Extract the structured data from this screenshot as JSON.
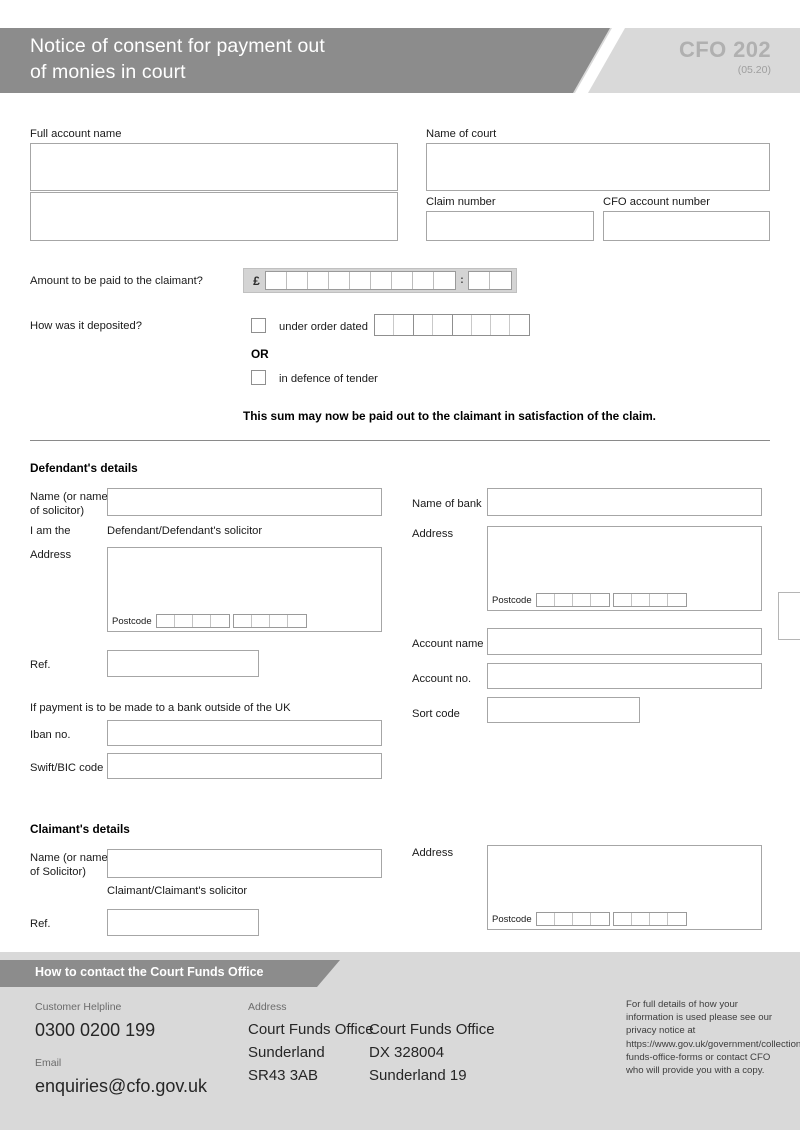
{
  "header": {
    "title_line1": "Notice of consent for payment out",
    "title_line2": "of monies in court",
    "form_code": "CFO 202",
    "form_version": "(05.20)"
  },
  "account": {
    "full_account_name_label": "Full account name",
    "full_account_name_value": "",
    "full_account_name_value2": ""
  },
  "court": {
    "name_of_court_label": "Name of court",
    "name_of_court_value": "",
    "claim_number_label": "Claim number",
    "claim_number_value": "",
    "cfo_account_number_label": "CFO account number",
    "cfo_account_number_value": ""
  },
  "amount": {
    "label": "Amount to be paid to the claimant?",
    "currency_symbol": "£",
    "decimal_separator": ":",
    "pounds_cells": 9,
    "pence_cells": 2,
    "value": ""
  },
  "deposit": {
    "label": "How was it deposited?",
    "option_order_label": "under order dated",
    "option_order_checked": false,
    "or_label": "OR",
    "option_tender_label": "in defence of tender",
    "option_tender_checked": false,
    "date_value": ""
  },
  "statement": "This sum may now be paid out to the claimant in satisfaction of the claim.",
  "defendant": {
    "section_title": "Defendant's details",
    "name_label_line1": "Name (or name",
    "name_label_line2": "of solicitor)",
    "name_value": "",
    "i_am_the_label": "I am the",
    "i_am_the_value": "Defendant/Defendant's solicitor",
    "address_label": "Address",
    "address_value": "",
    "postcode_label": "Postcode",
    "postcode_value": "",
    "ref_label": "Ref.",
    "ref_value": "",
    "overseas_note": "If payment is to be made to a bank outside of the UK",
    "iban_label": "Iban no.",
    "iban_value": "",
    "swift_label": "Swift/BIC code",
    "swift_value": ""
  },
  "bank": {
    "name_label": "Name of bank",
    "name_value": "",
    "address_label": "Address",
    "address_value": "",
    "postcode_label": "Postcode",
    "postcode_value": "",
    "account_name_label": "Account name",
    "account_name_value": "",
    "account_no_label": "Account no.",
    "account_no_value": "",
    "sort_code_label": "Sort code",
    "sort_code_value": ""
  },
  "claimant": {
    "section_title": "Claimant's details",
    "name_label_line1": "Name (or name",
    "name_label_line2": "of Solicitor)",
    "name_value": "",
    "role_value": "Claimant/Claimant's solicitor",
    "ref_label": "Ref.",
    "ref_value": "",
    "address_label": "Address",
    "address_value": "",
    "postcode_label": "Postcode",
    "postcode_value": ""
  },
  "footer": {
    "bar_title": "How to contact the Court Funds Office",
    "helpline_label": "Customer Helpline",
    "helpline_value": "0300 0200 199",
    "email_label": "Email",
    "email_value": "enquiries@cfo.gov.uk",
    "address_label": "Address",
    "address_col1_line1": "Court Funds Office",
    "address_col1_line2": "Sunderland",
    "address_col1_line3": "SR43 3AB",
    "address_col2_line1": "Court Funds Office",
    "address_col2_line2": "DX 328004",
    "address_col2_line3": "Sunderland 19",
    "privacy_notice": "For full details of how your information is used please see our privacy notice at https://www.gov.uk/government/collections/court-funds-office-forms or contact CFO who will provide you with a copy."
  },
  "colors": {
    "header_dark": "#8c8c8c",
    "header_light": "#d9d9d9",
    "footer_bg": "#d9d9d9",
    "text": "#1a1a1a",
    "box_border": "#a6a6a6"
  }
}
